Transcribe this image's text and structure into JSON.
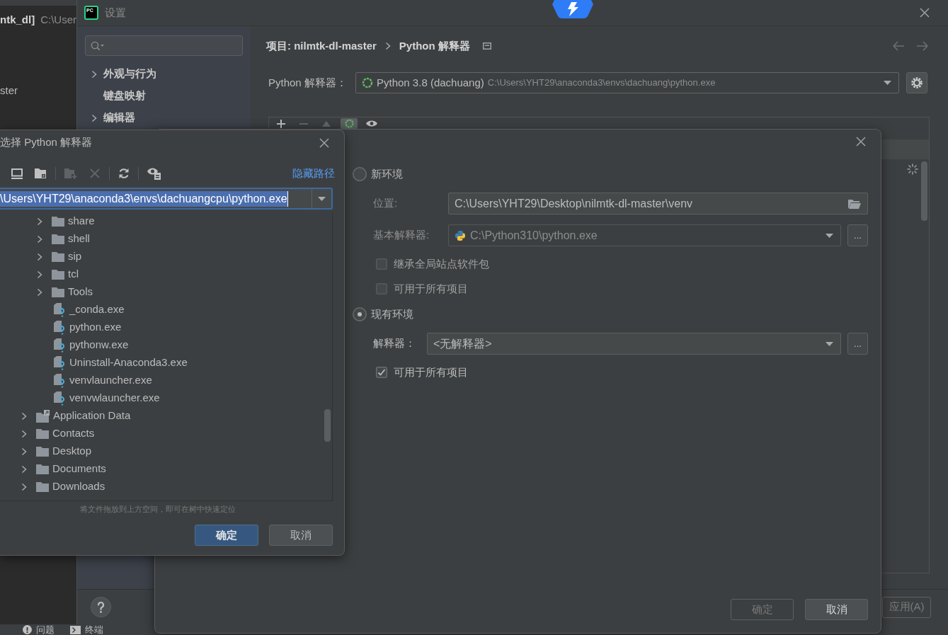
{
  "ide": {
    "title": {
      "project": "ntk_dl]",
      "path": "C:\\User"
    },
    "project_tree_item": "ster",
    "tool_windows": [
      {
        "label": "问题",
        "kind": "problems"
      },
      {
        "label": "终端",
        "kind": "terminal"
      }
    ]
  },
  "settings": {
    "title": "设置",
    "logo": "PC",
    "sidebar": {
      "items": [
        {
          "label": "外观与行为",
          "kind": "group",
          "expanded": false
        },
        {
          "label": "键盘映射",
          "kind": "item"
        },
        {
          "label": "编辑器",
          "kind": "group",
          "expanded": false
        }
      ]
    },
    "breadcrumb": [
      "项目: nilmtk-dl-master",
      "Python 解释器"
    ],
    "interpreter": {
      "label": "Python 解释器：",
      "name": "Python 3.8 (dachuang)",
      "path": "C:\\Users\\YHT29\\anaconda3\\envs\\dachuang\\python.exe"
    },
    "package_toolbar": [
      {
        "kind": "add",
        "selected": false,
        "disabled": false
      },
      {
        "kind": "remove",
        "selected": false,
        "disabled": true
      },
      {
        "kind": "up",
        "selected": false,
        "disabled": true
      },
      {
        "kind": "conda",
        "selected": true,
        "disabled": false
      },
      {
        "kind": "eye",
        "selected": false,
        "disabled": false
      }
    ],
    "buttons": [
      {
        "label": "应用(A)",
        "disabled": true
      }
    ]
  },
  "add_interpreter": {
    "environments": [
      {
        "kind": "new",
        "label": "新环境",
        "selected": false,
        "fields": [
          {
            "kind": "path",
            "label": "位置:",
            "value": "C:\\Users\\YHT29\\Desktop\\nilmtk-dl-master\\venv"
          },
          {
            "kind": "interpreter-select",
            "label": "基本解释器:",
            "value": "C:\\Python310\\python.exe",
            "disabled": true,
            "browse": "..."
          }
        ],
        "checkboxes": [
          {
            "label": "继承全局站点软件包",
            "checked": false
          },
          {
            "label": "可用于所有项目",
            "checked": false
          }
        ]
      },
      {
        "kind": "existing",
        "label": "现有环境",
        "selected": true,
        "fields": [
          {
            "kind": "select",
            "label": "解释器：",
            "value": "<无解释器>",
            "disabled": false,
            "browse": "..."
          }
        ],
        "checkboxes": [
          {
            "label": "可用于所有项目",
            "checked": true
          }
        ]
      }
    ],
    "buttons": [
      {
        "label": "确定",
        "disabled": true
      },
      {
        "label": "取消",
        "disabled": false
      }
    ]
  },
  "file_chooser": {
    "title": "选择 Python 解释器",
    "toolbar": [
      {
        "kind": "desktop",
        "disabled": false
      },
      {
        "kind": "home",
        "disabled": false
      },
      {
        "kind": "separator"
      },
      {
        "kind": "new-folder",
        "disabled": true
      },
      {
        "kind": "delete",
        "disabled": true
      },
      {
        "kind": "separator"
      },
      {
        "kind": "refresh",
        "disabled": false
      },
      {
        "kind": "separator"
      },
      {
        "kind": "show-hidden",
        "disabled": false
      }
    ],
    "hide_path_link": "隐藏路径",
    "path": {
      "value": "\\Users\\YHT29\\anaconda3\\envs\\dachuangcpu\\python.exe",
      "selected": true
    },
    "tree": {
      "items": [
        {
          "children": [
            {
              "label": "share",
              "kind": "folder",
              "expanded": false
            },
            {
              "label": "shell",
              "kind": "folder",
              "expanded": false
            },
            {
              "label": "sip",
              "kind": "folder",
              "expanded": false
            },
            {
              "label": "tcl",
              "kind": "folder",
              "expanded": false
            },
            {
              "label": "Tools",
              "kind": "folder",
              "expanded": false
            },
            {
              "label": "_conda.exe",
              "kind": "file"
            },
            {
              "label": "python.exe",
              "kind": "file"
            },
            {
              "label": "pythonw.exe",
              "kind": "file"
            },
            {
              "label": "Uninstall-Anaconda3.exe",
              "kind": "file"
            },
            {
              "label": "venvlauncher.exe",
              "kind": "file"
            },
            {
              "label": "venvwlauncher.exe",
              "kind": "file"
            }
          ]
        },
        {
          "label": "Application Data",
          "kind": "shortcut-folder",
          "expanded": false
        },
        {
          "label": "Contacts",
          "kind": "folder",
          "expanded": false
        },
        {
          "label": "Desktop",
          "kind": "folder",
          "expanded": false
        },
        {
          "label": "Documents",
          "kind": "folder",
          "expanded": false
        },
        {
          "label": "Downloads",
          "kind": "folder",
          "expanded": false
        }
      ]
    },
    "hint": "将文件拖放到上方空间，即可在树中快速定位",
    "buttons": [
      {
        "label": "确定",
        "kind": "primary"
      },
      {
        "label": "取消",
        "kind": "secondary"
      }
    ]
  }
}
